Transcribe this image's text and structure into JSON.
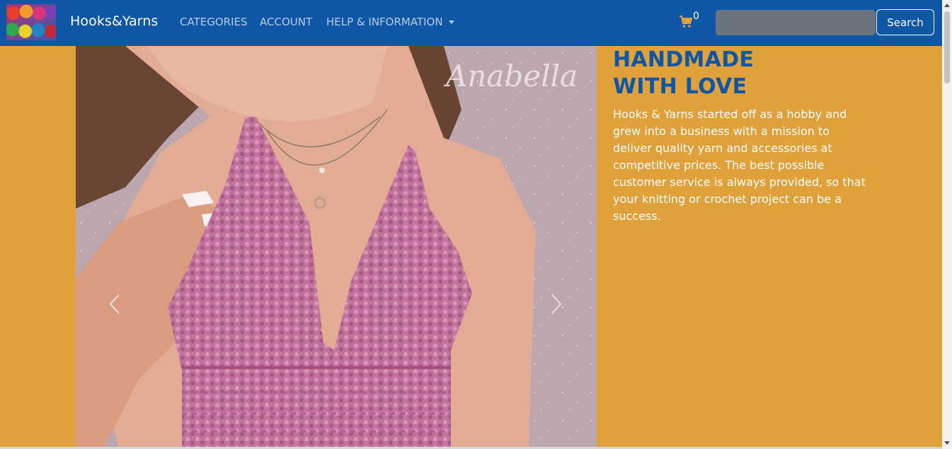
{
  "navbar": {
    "brand": "Hooks&Yarns",
    "links": [
      {
        "label": "CATEGORIES"
      },
      {
        "label": "ACCOUNT"
      },
      {
        "label": "HELP & INFORMATION"
      }
    ],
    "cart_count": "0",
    "search": {
      "placeholder": "",
      "value": "",
      "button_label": "Search"
    },
    "logo_icon": "yarn-balls-logo",
    "cart_icon": "shopping-cart-icon"
  },
  "carousel": {
    "watermark": "Anabella",
    "prev_icon": "chevron-left-icon",
    "next_icon": "chevron-right-icon"
  },
  "hero": {
    "title": "HANDMADE WITH LOVE",
    "text": "Hooks & Yarns started off as a hobby and grew into a business with a mission to deliver quality yarn and accessories at competitive prices. The best possible customer service is always provided, so that your knitting or crochet project can be a success."
  },
  "colors": {
    "navbar": "#0E57A6",
    "page_background": "#E0A13A",
    "cart": "#E0A13A",
    "nav_link": "#BCCBE3",
    "search_input": "#6C757D"
  }
}
